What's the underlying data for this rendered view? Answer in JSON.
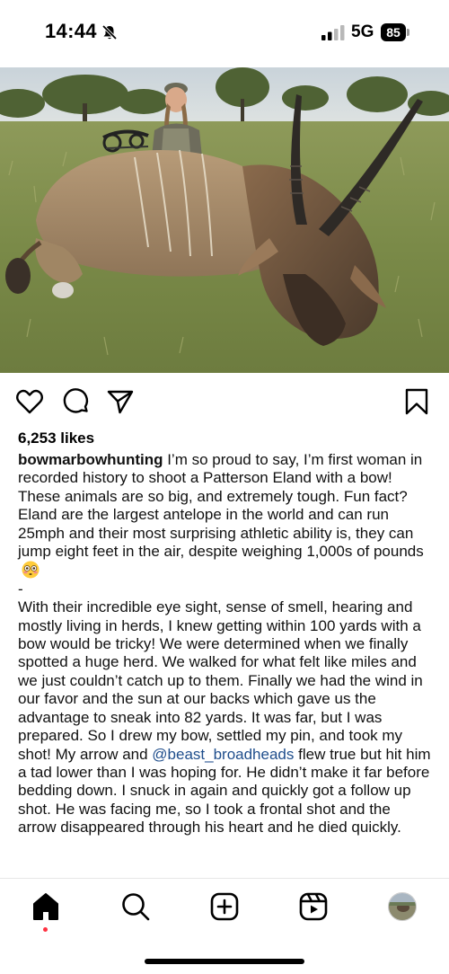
{
  "status_bar": {
    "time": "14:44",
    "network": "5G",
    "battery": "85"
  },
  "post": {
    "image_alt": "Hunter kneeling behind a harvested eland with a compound bow in savanna grassland",
    "likes": "6,253 likes",
    "username": "bowmarbowhunting",
    "caption_part1": " I’m so proud to say, I’m first woman in recorded history to shoot a Patterson Eland with a bow! These animals are so big, and extremely tough. Fun fact? Eland are the largest antelope in the world and can run 25mph and their most surprising athletic ability is, they can jump eight feet in the air, despite weighing 1,000s of pounds",
    "caption_divider": "-",
    "caption_part2": "With their incredible eye sight, sense of smell, hearing and mostly living in herds, I knew getting within 100 yards with a bow would be tricky! We were determined when we finally spotted a huge herd. We walked for what felt like miles and we just couldn’t catch up to them. Finally we had the wind in our favor and the sun at our backs which gave us the advantage to sneak into 82 yards. It was far, but I was prepared. So I drew my bow, settled my pin, and took my shot! My arrow and ",
    "mention": "@beast_broadheads",
    "caption_part3": " flew true but hit him a tad lower than I was hoping for. He didn’t make it far before bedding down. I snuck in again and quickly got a follow up shot. He was facing me, so I took a frontal shot and the arrow disappeared through his heart and he died quickly."
  },
  "icons": {
    "like": "heart-icon",
    "comment": "comment-icon",
    "share": "paper-plane-icon",
    "save": "bookmark-icon",
    "nav": [
      "home-icon",
      "search-icon",
      "create-icon",
      "reels-icon",
      "profile-avatar"
    ]
  },
  "colors": {
    "mention": "#1f4e8c",
    "notification_dot": "#ff3040"
  }
}
